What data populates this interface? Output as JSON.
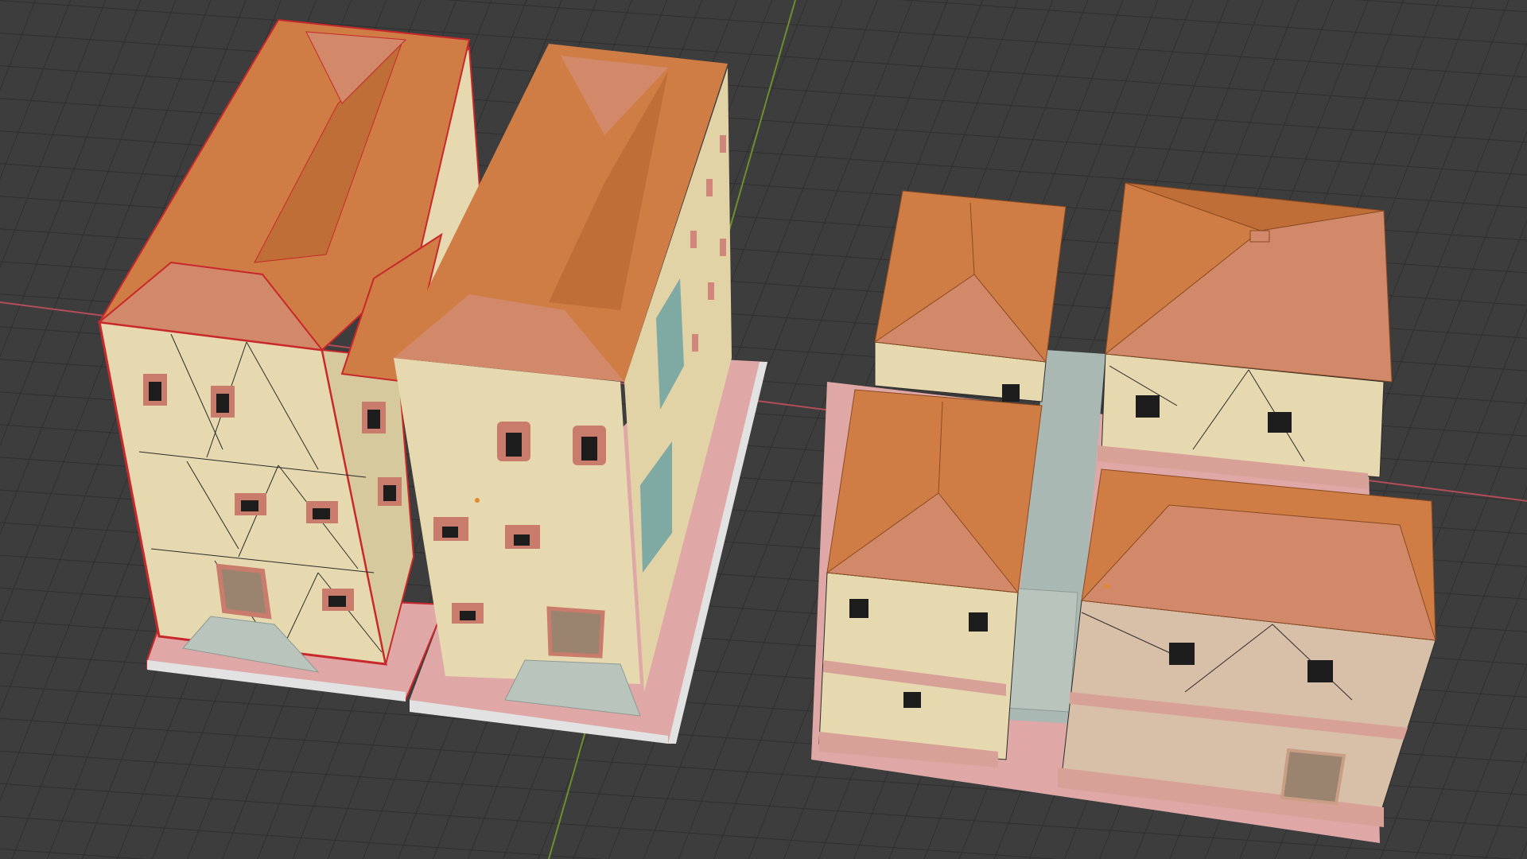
{
  "app": {
    "name": "",
    "view": ""
  },
  "viewport": {
    "background": "#3d3d3d",
    "grid_color": "#2f2f2f",
    "axis_x_color": "#b34d57",
    "axis_y_color": "#6e8f2b"
  },
  "scene": {
    "objects": [
      {
        "id": "building-left-tall",
        "selected": true,
        "outline_color": "#c8282b"
      },
      {
        "id": "building-middle-tall",
        "selected": false
      },
      {
        "id": "house-right-top-small",
        "selected": false
      },
      {
        "id": "house-right-top-large",
        "selected": false
      },
      {
        "id": "house-right-bottom-small",
        "selected": false
      },
      {
        "id": "house-right-bottom-large",
        "selected": false
      }
    ],
    "palette": {
      "roof_light": "#d1896a",
      "roof_main": "#cf7d44",
      "roof_dark": "#c06e38",
      "wall_cream": "#e6d9b0",
      "wall_shadow": "#d7c99e",
      "wall_pink": "#d8bfa8",
      "base_pink": "#e0a7a7",
      "base_white": "#e2e2e2",
      "window_frame": "#c97c6c",
      "window_glass": "#1d1d1d",
      "door": "#9a8470",
      "stair": "#b9c4bd",
      "shutter_teal": "#7fa9a3",
      "alley": "#aab8b4"
    }
  }
}
